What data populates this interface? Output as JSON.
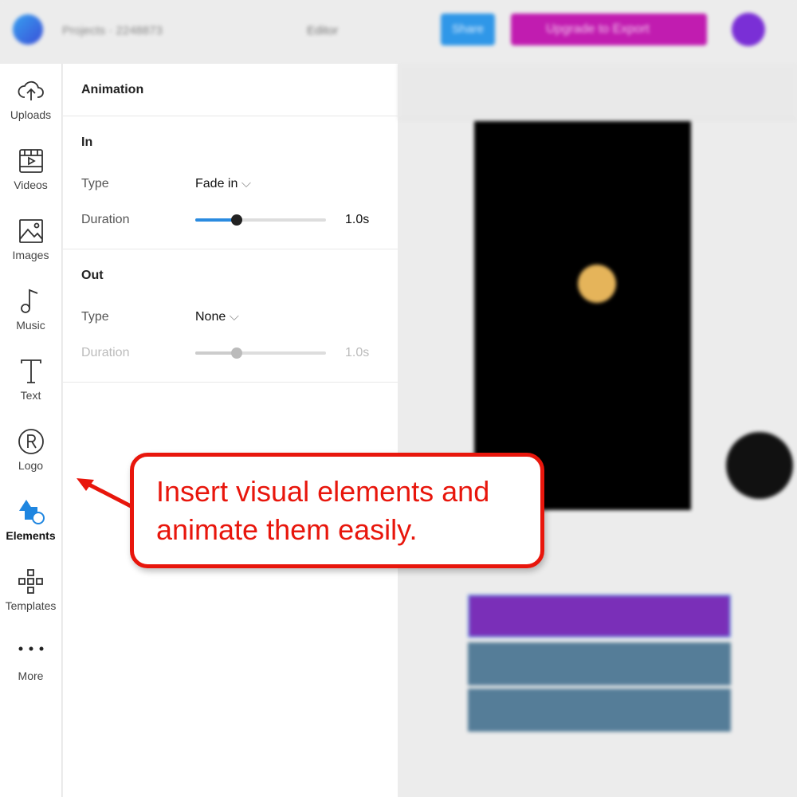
{
  "header": {
    "breadcrumb": "Projects  ·  2248873",
    "editor_label": "Editor",
    "share_label": "Share",
    "upgrade_label": "Upgrade to Export",
    "colors": {
      "share": "#2f97e8",
      "upgrade": "#c11cb0",
      "avatar": "#7a2fd6"
    }
  },
  "sidebar": {
    "items": [
      {
        "label": "Uploads",
        "icon": "cloud-upload-icon"
      },
      {
        "label": "Videos",
        "icon": "video-icon"
      },
      {
        "label": "Images",
        "icon": "image-icon"
      },
      {
        "label": "Music",
        "icon": "music-note-icon"
      },
      {
        "label": "Text",
        "icon": "text-icon"
      },
      {
        "label": "Logo",
        "icon": "registered-icon"
      },
      {
        "label": "Elements",
        "icon": "shapes-icon",
        "active": true
      },
      {
        "label": "Templates",
        "icon": "templates-icon"
      },
      {
        "label": "More",
        "icon": "more-icon"
      }
    ]
  },
  "panel": {
    "title": "Animation",
    "in": {
      "heading": "In",
      "type_label": "Type",
      "type_value": "Fade in",
      "duration_label": "Duration",
      "duration_value": "1.0s",
      "duration_fraction": 0.32
    },
    "out": {
      "heading": "Out",
      "type_label": "Type",
      "type_value": "None",
      "duration_label": "Duration",
      "duration_value": "1.0s",
      "duration_fraction": 0.32,
      "disabled": true
    }
  },
  "callout": {
    "text": "Insert visual elements and animate them easily.",
    "color": "#e8160c"
  }
}
